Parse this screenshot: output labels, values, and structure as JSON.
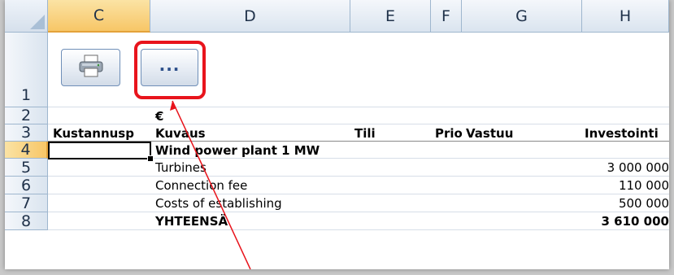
{
  "columns": [
    "C",
    "D",
    "E",
    "F",
    "G",
    "H"
  ],
  "rows": [
    "1",
    "2",
    "3",
    "4",
    "5",
    "6",
    "7",
    "8"
  ],
  "active_column": "C",
  "active_row": "4",
  "toolbar": {
    "print_icon": "printer-icon",
    "more_label": "..."
  },
  "cells": {
    "d2": "€",
    "headers": {
      "c": "Kustannusp",
      "d": "Kuvaus",
      "e": "Tili",
      "f": "Prio",
      "g": "Vastuu",
      "h": "Investointi"
    },
    "r4": {
      "d": "Wind power plant 1 MW"
    },
    "r5": {
      "d": "Turbines",
      "h": "3 000 000"
    },
    "r6": {
      "d": "Connection fee",
      "h": "110 000"
    },
    "r7": {
      "d": "Costs of establishing",
      "h": "500 000"
    },
    "r8": {
      "d": "YHTEENSÄ",
      "h": "3 610 000"
    }
  },
  "annotation": {
    "highlight_color": "#e8141c"
  }
}
